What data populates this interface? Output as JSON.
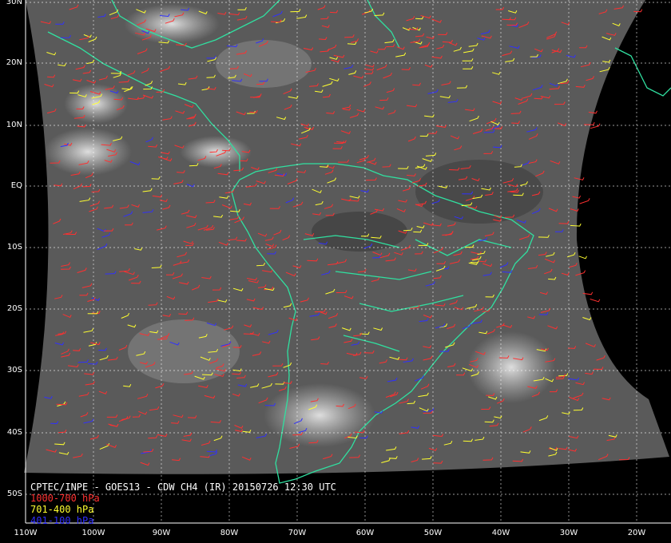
{
  "title": "CPTEC/INPE - GOES13 - CDW CH4 (IR) 20150726 12:30 UTC",
  "legend": [
    {
      "label": "1000-700 hPa",
      "color": "#ff3030"
    },
    {
      "label": "701-400 hPa",
      "color": "#ffff30"
    },
    {
      "label": "401-100 hPa",
      "color": "#3030ff"
    }
  ],
  "lat_labels": [
    "30N",
    "20N",
    "10N",
    "EQ",
    "10S",
    "20S",
    "30S",
    "40S",
    "50S"
  ],
  "lon_labels": [
    "110W",
    "100W",
    "90W",
    "80W",
    "70W",
    "60W",
    "50W",
    "40W",
    "30W",
    "20W"
  ],
  "colors": {
    "coast": "#30e0a0",
    "grid": "#ffffff",
    "background": "#000000"
  }
}
